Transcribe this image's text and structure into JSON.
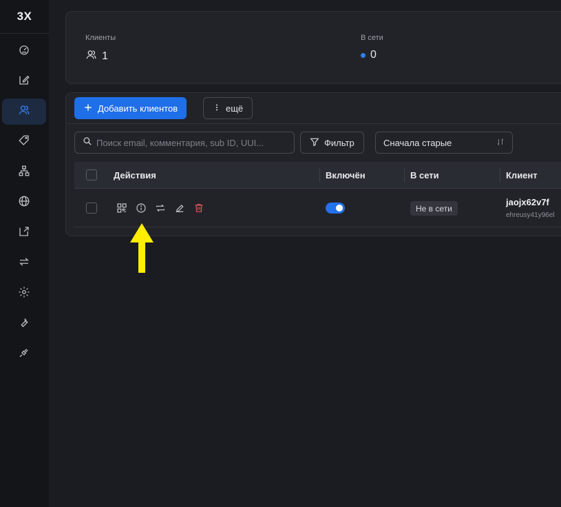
{
  "app": {
    "logo": "3X"
  },
  "sidebar": {
    "items": [
      {
        "icon": "dashboard-icon",
        "active": false
      },
      {
        "icon": "edit-icon",
        "active": false
      },
      {
        "icon": "users-icon",
        "active": true
      },
      {
        "icon": "tag-icon",
        "active": false
      },
      {
        "icon": "sitemap-icon",
        "active": false
      },
      {
        "icon": "globe-icon",
        "active": false
      },
      {
        "icon": "export-icon",
        "active": false
      },
      {
        "icon": "swap-icon",
        "active": false
      },
      {
        "icon": "settings-icon",
        "active": false
      },
      {
        "icon": "wrench-icon",
        "active": false
      },
      {
        "icon": "plug-icon",
        "active": false
      }
    ]
  },
  "stats": {
    "clients_label": "Клиенты",
    "clients_value": "1",
    "online_label": "В сети",
    "online_value": "0"
  },
  "toolbar": {
    "add_label": "Добавить клиентов",
    "more_label": "ещё"
  },
  "search": {
    "placeholder": "Поиск email, комментария, sub ID, UUI..."
  },
  "filter": {
    "label": "Фильтр"
  },
  "sort": {
    "selected": "Сначала старые"
  },
  "table": {
    "headers": {
      "actions": "Действия",
      "enabled": "Включён",
      "online": "В сети",
      "client": "Клиент"
    },
    "rows": [
      {
        "enabled": true,
        "online_status": "Не в сети",
        "client_name": "jaojx62v7f",
        "client_sub": "ehreusy41y96el"
      }
    ]
  },
  "colors": {
    "accent": "#1f6fe8",
    "danger": "#e05555",
    "highlight_arrow": "#ffee00"
  }
}
